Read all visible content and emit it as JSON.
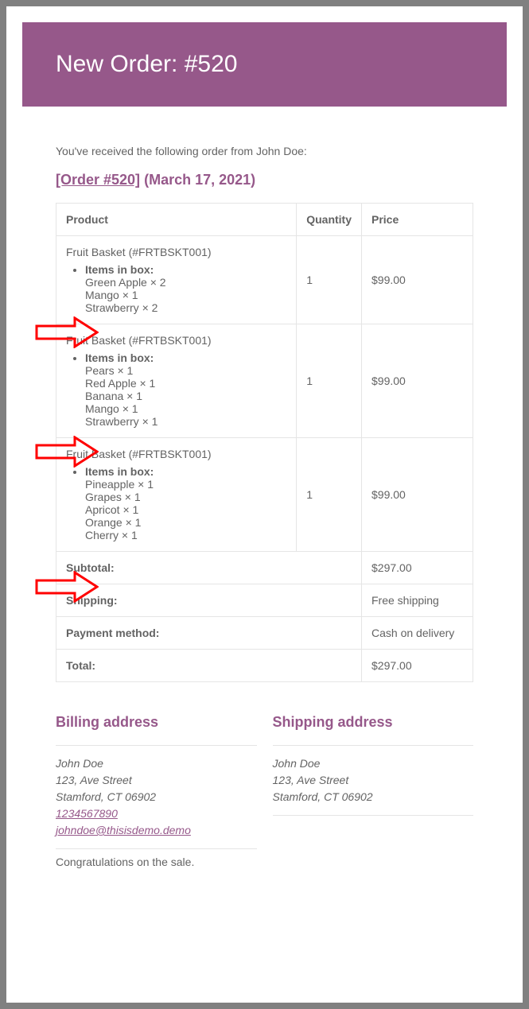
{
  "header": {
    "title": "New Order: #520"
  },
  "intro": "You've received the following order from John Doe:",
  "order_line": {
    "link_text": "[Order #520]",
    "date_text": "(March 17, 2021)"
  },
  "columns": {
    "product": "Product",
    "quantity": "Quantity",
    "price": "Price"
  },
  "items_label": "Items in box:",
  "products": [
    {
      "name": "Fruit Basket (#FRTBSKT001)",
      "contents": [
        "Green Apple × 2",
        "Mango × 1",
        "Strawberry × 2"
      ],
      "qty": "1",
      "price": "$99.00"
    },
    {
      "name": "Fruit Basket (#FRTBSKT001)",
      "contents": [
        "Pears × 1",
        "Red Apple × 1",
        "Banana × 1",
        "Mango × 1",
        "Strawberry × 1"
      ],
      "qty": "1",
      "price": "$99.00"
    },
    {
      "name": "Fruit Basket (#FRTBSKT001)",
      "contents": [
        "Pineapple × 1",
        "Grapes × 1",
        "Apricot × 1",
        "Orange × 1",
        "Cherry × 1"
      ],
      "qty": "1",
      "price": "$99.00"
    }
  ],
  "totals": {
    "subtotal_label": "Subtotal:",
    "subtotal_value": "$297.00",
    "shipping_label": "Shipping:",
    "shipping_value": "Free shipping",
    "payment_label": "Payment method:",
    "payment_value": "Cash on delivery",
    "total_label": "Total:",
    "total_value": "$297.00"
  },
  "billing": {
    "heading": "Billing address",
    "name": "John Doe",
    "street": "123, Ave Street",
    "city": "Stamford, CT 06902",
    "phone": "1234567890",
    "email": "johndoe@thisisdemo.demo"
  },
  "shipping": {
    "heading": "Shipping address",
    "name": "John Doe",
    "street": "123, Ave Street",
    "city": "Stamford, CT 06902"
  },
  "congrats": "Congratulations on the sale."
}
